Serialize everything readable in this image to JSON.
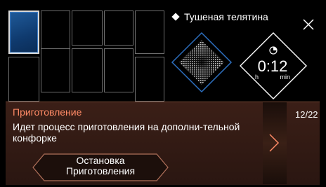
{
  "header": {
    "dish_name": "Тушеная телятина"
  },
  "timer": {
    "value": "0:12",
    "unit_h": "h",
    "unit_min": "min"
  },
  "panel": {
    "title": "Приготовление",
    "message": "Идет процесс приготовления на дополни-тельной конфорке",
    "stop_button_line1": "Остановка",
    "stop_button_line2": "Приготовления",
    "page_indicator": "12/22"
  },
  "colors": {
    "accent_orange": "#ff8a66",
    "active_zone_blue": "#1f5a99",
    "panel_bg": "#2a1611"
  },
  "icons": [
    "diamond-icon",
    "close-icon",
    "heat-pattern-icon",
    "clock-icon",
    "chevron-right-icon"
  ]
}
